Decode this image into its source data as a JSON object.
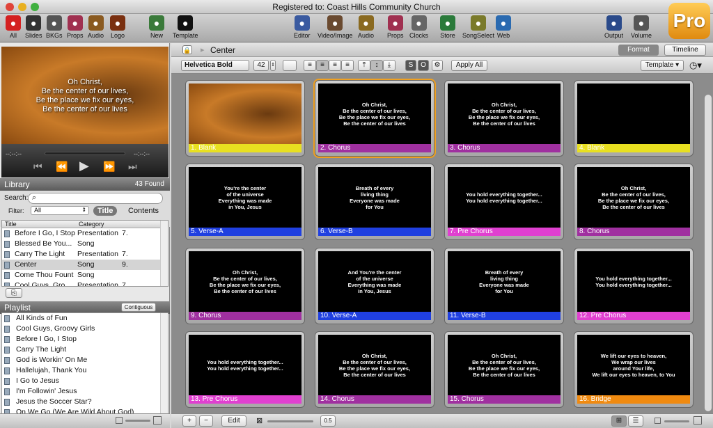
{
  "window": {
    "title": "Registered to: Coast Hills Community Church"
  },
  "toolbar": {
    "items": [
      {
        "label": "All",
        "icon": "close-all-icon",
        "color": "#d42020"
      },
      {
        "label": "Slides",
        "icon": "slides-icon",
        "color": "#333333"
      },
      {
        "label": "BKGs",
        "icon": "backgrounds-icon",
        "color": "#555555"
      },
      {
        "label": "Props",
        "icon": "props-icon",
        "color": "#a03050"
      },
      {
        "label": "Audio",
        "icon": "audio-icon",
        "color": "#8a5a20"
      },
      {
        "label": "Logo",
        "icon": "logo-icon",
        "color": "#7a3010"
      },
      {
        "label": "New",
        "icon": "new-document-icon",
        "color": "#3a7a3a"
      },
      {
        "label": "Template",
        "icon": "template-icon",
        "color": "#111111"
      },
      {
        "label": "Editor",
        "icon": "editor-icon",
        "color": "#3a5aa0"
      },
      {
        "label": "Video/Image",
        "icon": "film-icon",
        "color": "#6a4a30"
      },
      {
        "label": "Audio",
        "icon": "speaker-icon",
        "color": "#8a6a20"
      },
      {
        "label": "Props",
        "icon": "props-icon",
        "color": "#a03050"
      },
      {
        "label": "Clocks",
        "icon": "clock-icon",
        "color": "#666666"
      },
      {
        "label": "Store",
        "icon": "store-icon",
        "color": "#2a7a3a"
      },
      {
        "label": "SongSelect",
        "icon": "songselect-icon",
        "color": "#7a7a2a"
      },
      {
        "label": "Web",
        "icon": "globe-icon",
        "color": "#2a6ab0"
      },
      {
        "label": "Output",
        "icon": "monitor-icon",
        "color": "#2a4a8a"
      },
      {
        "label": "Volume",
        "icon": "volume-icon",
        "color": "#555555"
      }
    ],
    "brand": "Pro"
  },
  "preview": {
    "lines": [
      "Oh Christ,",
      "Be the center of our lives,",
      "Be the place we fix our eyes,",
      "Be the center of our lives"
    ],
    "time_left": "--:--:--",
    "time_right": "--:--:--"
  },
  "library": {
    "title": "Library",
    "found": "43 Found",
    "search_label": "Search:",
    "search_placeholder": "",
    "filter_label": "Filter:",
    "filter_value": "All",
    "tab_title": "Title",
    "tab_contents": "Contents",
    "col_title": "Title",
    "col_category": "Category",
    "rows": [
      {
        "title": "Before I Go, I Stop",
        "category": "Presentation",
        "n": "7."
      },
      {
        "title": "Blessed Be You...",
        "category": "Song",
        "n": ""
      },
      {
        "title": "Carry The Light",
        "category": "Presentation",
        "n": "7."
      },
      {
        "title": "Center",
        "category": "Song",
        "n": "9."
      },
      {
        "title": "Come Thou Fount",
        "category": "Song",
        "n": ""
      },
      {
        "title": "Cool Guys, Gro...",
        "category": "Presentation",
        "n": "7."
      }
    ]
  },
  "playlist": {
    "title": "Playlist",
    "mode": "Contiguous",
    "items": [
      "All Kinds of Fun",
      "Cool Guys, Groovy Girls",
      "Before I Go, I Stop",
      "Carry The Light",
      "God is Workin' On Me",
      "Hallelujah, Thank You",
      "I Go to Jesus",
      "I'm Followin' Jesus",
      "Jesus the Soccer Star?",
      "On We Go (We Are Wild About God)"
    ]
  },
  "main": {
    "document": "Center",
    "tab_format": "Format",
    "tab_timeline": "Timeline",
    "font": "Helvetica Bold",
    "font_size": "42",
    "apply_all": "Apply All",
    "template": "Template",
    "s_label": "S",
    "o_label": "O"
  },
  "slides": [
    {
      "label": "1. Blank",
      "text": "",
      "bg": true,
      "color": "#e8e020"
    },
    {
      "label": "2. Chorus",
      "text": "Oh Christ,\nBe the center of our lives,\nBe the place we fix our eyes,\nBe the center of our lives",
      "bg": false,
      "color": "#a030a0",
      "selected": true
    },
    {
      "label": "3. Chorus",
      "text": "Oh Christ,\nBe the center of our lives,\nBe the place we fix our eyes,\nBe the center of our lives",
      "bg": false,
      "color": "#a030a0"
    },
    {
      "label": "4. Blank",
      "text": "",
      "bg": false,
      "color": "#e8e020"
    },
    {
      "label": "5. Verse-A",
      "text": "You're the center\nof the universe\nEverything was made\nin You, Jesus",
      "bg": false,
      "color": "#2040e0"
    },
    {
      "label": "6. Verse-B",
      "text": "Breath of every\nliving thing\nEveryone was made\nfor You",
      "bg": false,
      "color": "#2040e0"
    },
    {
      "label": "7. Pre Chorus",
      "text": "You hold everything together...\nYou hold everything together...",
      "bg": false,
      "color": "#e040d0"
    },
    {
      "label": "8. Chorus",
      "text": "Oh Christ,\nBe the center of our lives,\nBe the place we fix our eyes,\nBe the center of our lives",
      "bg": false,
      "color": "#a030a0"
    },
    {
      "label": "9. Chorus",
      "text": "Oh Christ,\nBe the center of our lives,\nBe the place we fix our eyes,\nBe the center of our lives",
      "bg": false,
      "color": "#a030a0"
    },
    {
      "label": "10. Verse-A",
      "text": "And You're the center\nof the universe\nEverything was made\nin You, Jesus",
      "bg": false,
      "color": "#2040e0"
    },
    {
      "label": "11. Verse-B",
      "text": "Breath of every\nliving thing\nEveryone was made\nfor You",
      "bg": false,
      "color": "#2040e0"
    },
    {
      "label": "12. Pre Chorus",
      "text": "You hold everything together...\nYou hold everything together...",
      "bg": false,
      "color": "#e040d0"
    },
    {
      "label": "13. Pre Chorus",
      "text": "You hold everything together...\nYou hold everything together...",
      "bg": false,
      "color": "#e040d0"
    },
    {
      "label": "14. Chorus",
      "text": "Oh Christ,\nBe the center of our lives,\nBe the place we fix our eyes,\nBe the center of our lives",
      "bg": false,
      "color": "#a030a0"
    },
    {
      "label": "15. Chorus",
      "text": "Oh Christ,\nBe the center of our lives,\nBe the place we fix our eyes,\nBe the center of our lives",
      "bg": false,
      "color": "#a030a0"
    },
    {
      "label": "16. Bridge",
      "text": "We lift our eyes to heaven,\nWe wrap our lives\naround Your life,\nWe lift our eyes to heaven, to You",
      "bg": false,
      "color": "#f08a10"
    }
  ],
  "bottom": {
    "add": "+",
    "remove": "−",
    "edit": "Edit",
    "zoom_value": "0.5"
  }
}
